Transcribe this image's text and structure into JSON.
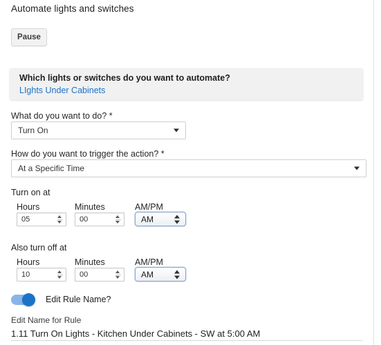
{
  "page": {
    "title": "Automate lights and switches"
  },
  "toolbar": {
    "pause_label": "Pause"
  },
  "info_card": {
    "question": "Which lights or switches do you want to automate?",
    "selection_link": "LIghts Under Cabinets"
  },
  "action_field": {
    "label": "What do you want to do? *",
    "value": "Turn On",
    "caret_icon": "chevron-down-icon"
  },
  "trigger_field": {
    "label": "How do you want to trigger the action? *",
    "value": "At a Specific Time",
    "caret_icon": "chevron-down-icon"
  },
  "turn_on": {
    "group_label": "Turn on at",
    "hours_label": "Hours",
    "hours_value": "05",
    "minutes_label": "Minutes",
    "minutes_value": "00",
    "ampm_label": "AM/PM",
    "ampm_value": "AM"
  },
  "turn_off": {
    "group_label": "Also turn off at",
    "hours_label": "Hours",
    "hours_value": "10",
    "minutes_label": "Minutes",
    "minutes_value": "00",
    "ampm_label": "AM/PM",
    "ampm_value": "AM"
  },
  "edit_rule": {
    "toggle_label": "Edit Rule Name?",
    "toggle_state": "on",
    "name_label": "Edit Name for Rule",
    "name_value": "1.11 Turn On Lights - Kitchen Under Cabinets - SW at 5:00 AM",
    "name_placeholder": "Edit Name for Rule"
  },
  "colors": {
    "link": "#1a73c8",
    "toggle_track": "#8ab4e8",
    "toggle_knob": "#1a73c8",
    "info_card_bg": "#f1f1f1",
    "button_bg": "#f2f2f2"
  }
}
